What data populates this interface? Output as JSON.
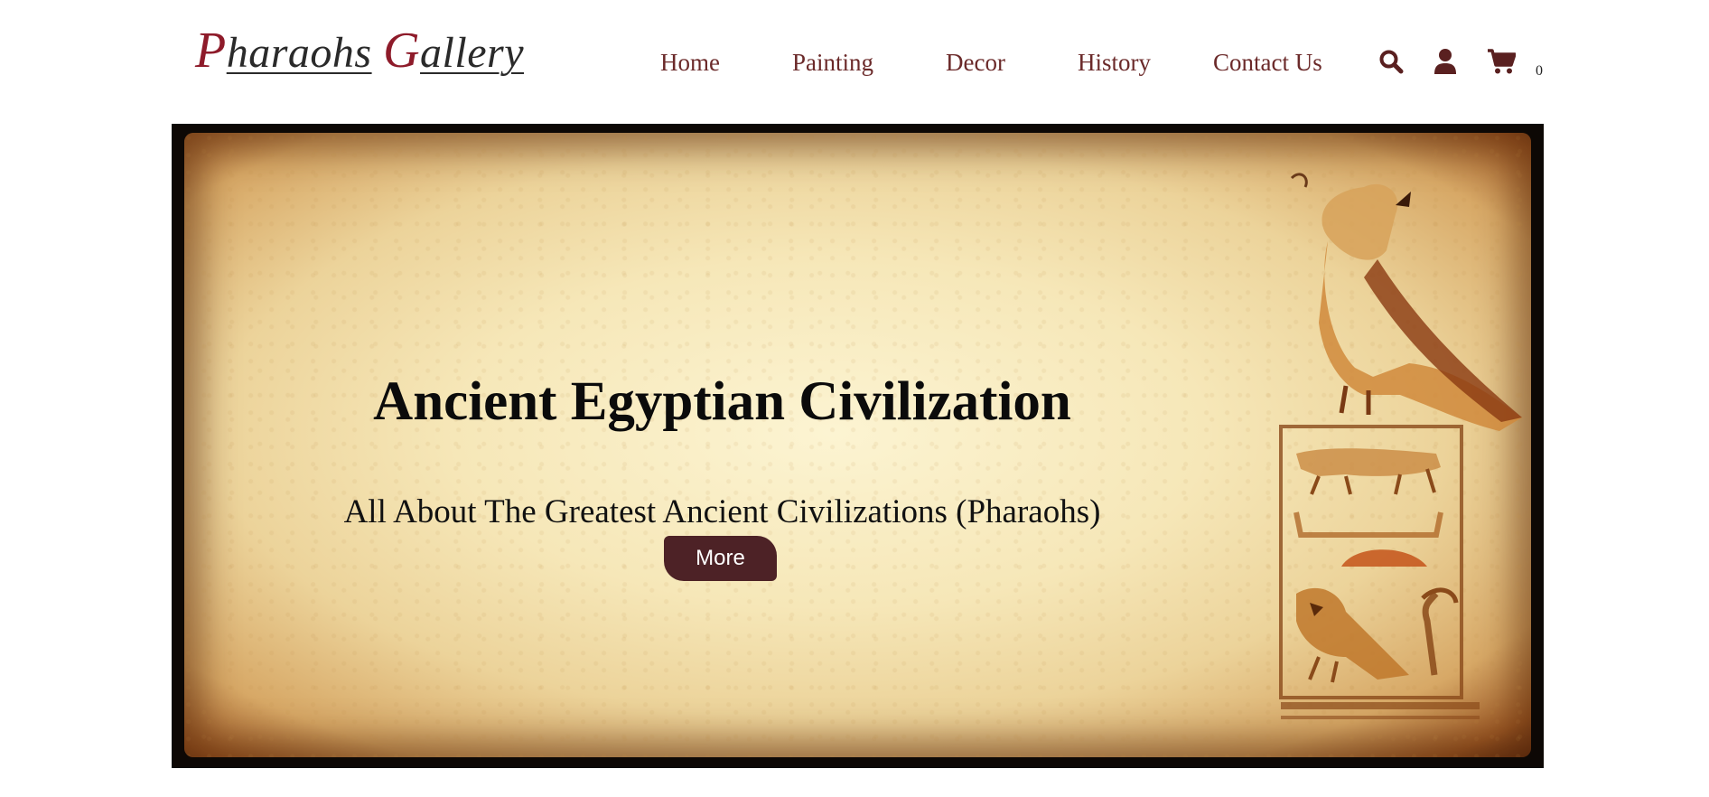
{
  "header": {
    "logo": {
      "initial_1": "P",
      "rest_1": "haraohs",
      "initial_2": "G",
      "rest_2": "allery"
    },
    "nav": [
      {
        "label": "Home"
      },
      {
        "label": "Painting"
      },
      {
        "label": "Decor"
      },
      {
        "label": "History"
      },
      {
        "label": "Contact Us"
      }
    ],
    "icons": {
      "search": "search-icon",
      "user": "user-icon",
      "cart": "cart-icon"
    },
    "cart_count": "0"
  },
  "hero": {
    "title": "Ancient Egyptian Civilization",
    "subtitle": "All About The Greatest Ancient Civilizations (Pharaohs)",
    "button_label": "More"
  },
  "colors": {
    "brand": "#8e1b2a",
    "nav_text": "#6b2a2a",
    "icon": "#5a2020",
    "button_bg": "#4d2226"
  }
}
